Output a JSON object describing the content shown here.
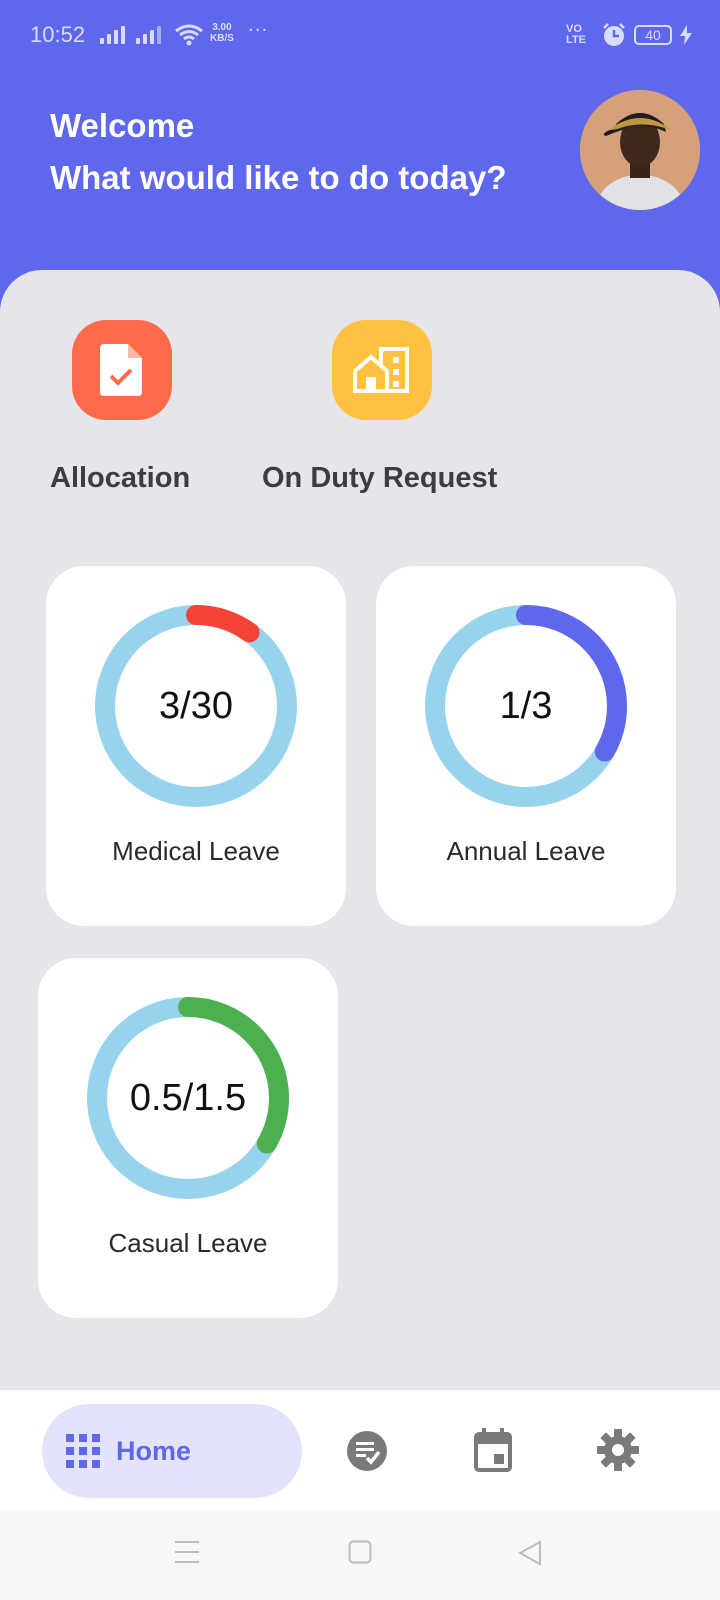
{
  "status_bar": {
    "time": "10:52",
    "network_speed_value": "3.00",
    "network_speed_unit": "KB/S",
    "more": "···",
    "volte": "VO LTE",
    "battery": "40",
    "icons": [
      "signal-icon",
      "wifi-icon",
      "alarm-icon",
      "battery-icon",
      "charging-icon"
    ]
  },
  "header": {
    "greeting": "Welcome",
    "subtitle": "What would like to do today?",
    "avatar": "user-avatar"
  },
  "quick_actions": [
    {
      "label": "Allocation",
      "icon": "document-check-icon",
      "color": "#FF6B4A"
    },
    {
      "label": "On Duty Request",
      "icon": "building-icon",
      "color": "#FFC13F"
    }
  ],
  "leave_cards": [
    {
      "label": "Medical Leave",
      "used": 3,
      "total": 30,
      "display": "3/30",
      "color": "#F44336"
    },
    {
      "label": "Annual Leave",
      "used": 1,
      "total": 3,
      "display": "1/3",
      "color": "#5F67EC"
    },
    {
      "label": "Casual Leave",
      "used": 0.5,
      "total": 1.5,
      "display": "0.5/1.5",
      "color": "#4CAF50"
    }
  ],
  "ring_track_color": "#98D3EE",
  "bottom_nav": {
    "home_label": "Home",
    "items": [
      "home-grid-icon",
      "tasks-check-icon",
      "calendar-icon",
      "settings-gear-icon"
    ],
    "active_color": "#5F67EC",
    "inactive_color": "#7A7A7A"
  },
  "colors": {
    "primary": "#5F67EC",
    "background": "#E6E5EA"
  }
}
